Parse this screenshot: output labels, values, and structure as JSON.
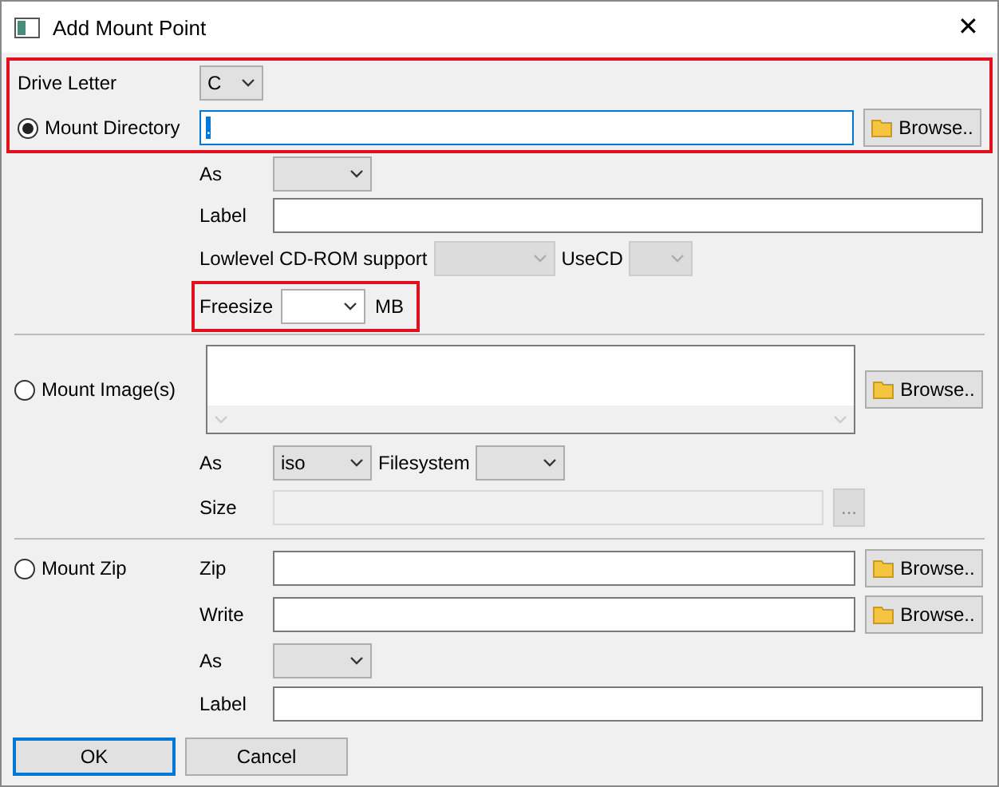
{
  "window": {
    "title": "Add Mount Point",
    "close": "✕"
  },
  "drive_letter": {
    "label": "Drive Letter",
    "select": {
      "value": "C",
      "disabled": false
    }
  },
  "mount_directory": {
    "label": "Mount Directory",
    "selected": true,
    "value": ".",
    "browse": "Browse..",
    "as": {
      "label": "As",
      "select": {
        "disabled": false
      }
    },
    "label_field": {
      "label": "Label"
    },
    "lowlevel": {
      "label": "Lowlevel CD-ROM support",
      "select": {
        "disabled": true
      }
    },
    "usecd": {
      "label": "UseCD",
      "select": {
        "disabled": true
      }
    },
    "freesize": {
      "label": "Freesize",
      "unit": "MB",
      "select": {
        "editable": true,
        "disabled": false
      }
    }
  },
  "mount_images": {
    "label": "Mount Image(s)",
    "selected": false,
    "browse": "Browse..",
    "as": {
      "label": "As",
      "select": {
        "value": "iso",
        "disabled": false
      }
    },
    "filesystem": {
      "label": "Filesystem",
      "select": {
        "disabled": false
      }
    },
    "size": {
      "label": "Size",
      "disabled": true,
      "button": "..."
    }
  },
  "mount_zip": {
    "label": "Mount Zip",
    "selected": false,
    "zip": {
      "label": "Zip",
      "browse": "Browse.."
    },
    "write": {
      "label": "Write",
      "browse": "Browse.."
    },
    "as": {
      "label": "As",
      "select": {
        "disabled": false
      }
    },
    "label_field": {
      "label": "Label"
    }
  },
  "buttons": [
    {
      "label": "OK",
      "default": true
    },
    {
      "label": "Cancel",
      "default": false
    }
  ]
}
